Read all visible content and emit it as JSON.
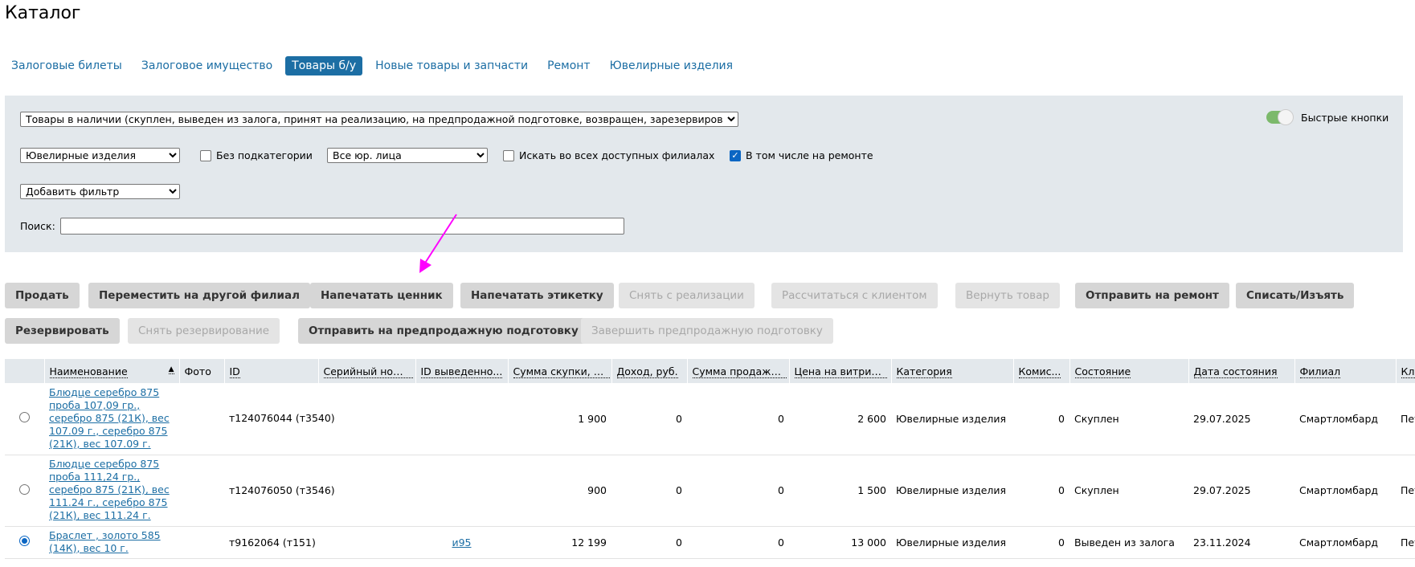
{
  "page_title": "Каталог",
  "tabs": [
    {
      "label": "Залоговые билеты"
    },
    {
      "label": "Залоговое имущество"
    },
    {
      "label": "Товары б/у",
      "active": true
    },
    {
      "label": "Новые товары и запчасти"
    },
    {
      "label": "Ремонт"
    },
    {
      "label": "Ювелирные изделия"
    }
  ],
  "filters": {
    "status_select": "Товары в наличии (скуплен, выведен из залога, принят на реализацию, на предпродажной подготовке, возвращен, зарезервирован)",
    "category_select": "Ювелирные изделия",
    "no_subcategory_label": "Без подкатегории",
    "legal_entity_select": "Все юр. лица",
    "search_all_branches_label": "Искать во всех доступных филиалах",
    "include_repair_label": "В том числе на ремонте",
    "include_repair_checked": true,
    "add_filter_select": "Добавить фильтр",
    "search_label": "Поиск:",
    "search_value": "",
    "quick_buttons_label": "Быстрые кнопки",
    "quick_buttons_on": true
  },
  "actions_row1": [
    {
      "label": "Продать",
      "enabled": true
    },
    {
      "label": "Переместить на другой филиал",
      "enabled": true
    },
    {
      "label": "Напечатать ценник",
      "enabled": true
    },
    {
      "label": "Напечатать этикетку",
      "enabled": true
    },
    {
      "label": "Снять с реализации",
      "enabled": false
    },
    {
      "label": "Рассчитаться с клиентом",
      "enabled": false
    },
    {
      "label": "Вернуть товар",
      "enabled": false
    },
    {
      "label": "Отправить на ремонт",
      "enabled": true
    },
    {
      "label": "Списать/Изъять",
      "enabled": true
    }
  ],
  "actions_row2": [
    {
      "label": "Резервировать",
      "enabled": true
    },
    {
      "label": "Снять резервирование",
      "enabled": false
    },
    {
      "label": "Отправить на предпродажную подготовку",
      "enabled": true
    },
    {
      "label": "Завершить предпродажную подготовку",
      "enabled": false
    }
  ],
  "table": {
    "columns": [
      "Наименование",
      "Фото",
      "ID",
      "Серийный номер",
      "ID выведенно...",
      "Сумма скупки, р...",
      "Доход, руб.",
      "Сумма продажи...",
      "Цена на витрин...",
      "Категория",
      "Комис...",
      "Состояние",
      "Дата состояния",
      "Филиал",
      "Кли"
    ],
    "rows": [
      {
        "name": "Блюдце серебро 875 проба 107,09 гр., серебро 875 (21К), вес 107.09 г., серебро 875 (21К), вес 107.09 г.",
        "photo": "",
        "id": "т124076044 (т3540)",
        "serial": "",
        "pledge_id": "",
        "buy_sum": "1 900",
        "income": "0",
        "sale_sum": "0",
        "price": "2 600",
        "category": "Ювелирные изделия",
        "commission": "0",
        "state": "Скуплен",
        "state_date": "29.07.2025",
        "branch": "Смартломбард",
        "client": "Пет",
        "selected": false
      },
      {
        "name": "Блюдце серебро 875 проба 111,24 гр., серебро 875 (21К), вес 111.24 г., серебро 875 (21К), вес 111.24 г.",
        "photo": "",
        "id": "т124076050 (т3546)",
        "serial": "",
        "pledge_id": "",
        "buy_sum": "900",
        "income": "0",
        "sale_sum": "0",
        "price": "1 500",
        "category": "Ювелирные изделия",
        "commission": "0",
        "state": "Скуплен",
        "state_date": "29.07.2025",
        "branch": "Смартломбард",
        "client": "Пет",
        "selected": false
      },
      {
        "name": "Браслет , золото 585 (14К), вес 10 г.",
        "photo": "",
        "id": "т9162064 (т151)",
        "serial": "",
        "pledge_id": "и95",
        "buy_sum": "12 199",
        "income": "0",
        "sale_sum": "0",
        "price": "13 000",
        "category": "Ювелирные изделия",
        "commission": "0",
        "state": "Выведен из залога",
        "state_date": "23.11.2024",
        "branch": "Смартломбард",
        "client": "Пет",
        "selected": true
      }
    ]
  }
}
